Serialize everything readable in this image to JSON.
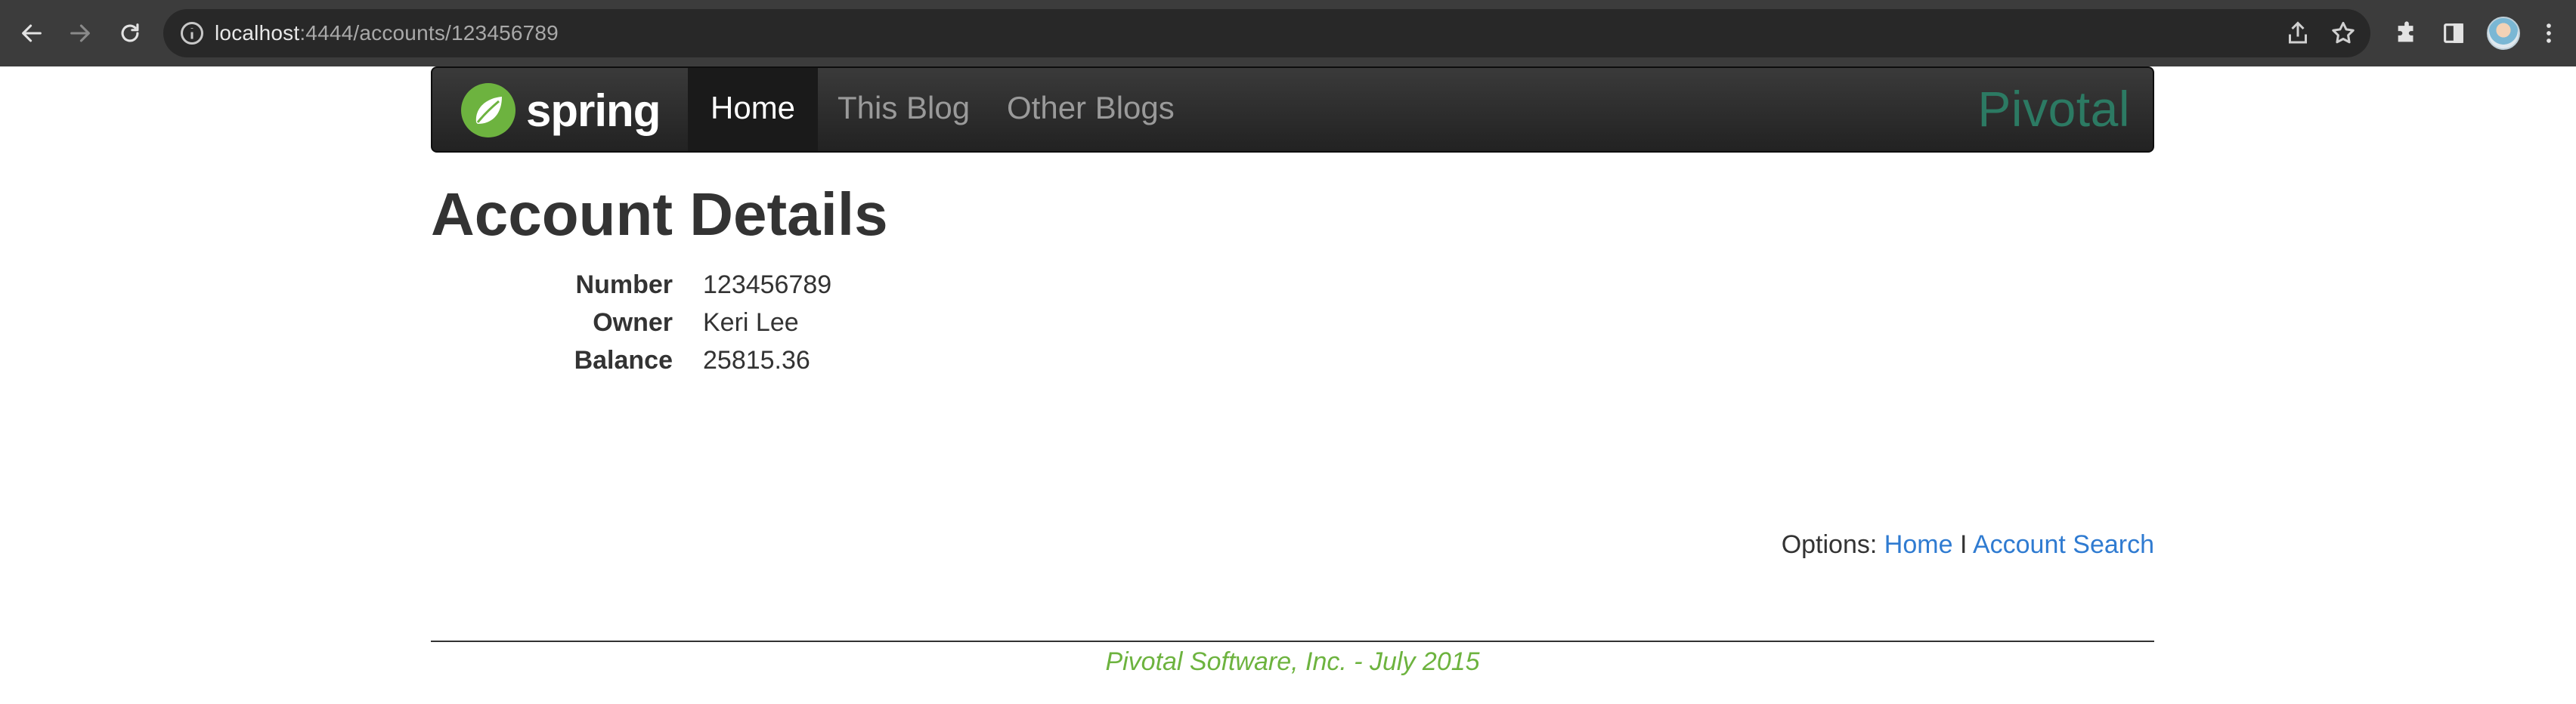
{
  "browser": {
    "url_host": "localhost",
    "url_path": ":4444/accounts/123456789"
  },
  "navbar": {
    "brand": "spring",
    "items": [
      {
        "label": "Home",
        "active": true
      },
      {
        "label": "This Blog",
        "active": false
      },
      {
        "label": "Other Blogs",
        "active": false
      }
    ],
    "partner_logo": "Pivotal"
  },
  "page": {
    "title": "Account Details",
    "details": [
      {
        "label": "Number",
        "value": "123456789"
      },
      {
        "label": "Owner",
        "value": "Keri Lee"
      },
      {
        "label": "Balance",
        "value": "25815.36"
      }
    ],
    "options": {
      "prefix": "Options:",
      "links": [
        {
          "label": "Home"
        },
        {
          "label": "Account Search"
        }
      ],
      "separator": "I"
    },
    "footer": "Pivotal Software, Inc. - July 2015"
  },
  "colors": {
    "spring_green": "#6db33f",
    "pivotal_teal": "#2c7a63",
    "link_blue": "#2f7bd1"
  }
}
